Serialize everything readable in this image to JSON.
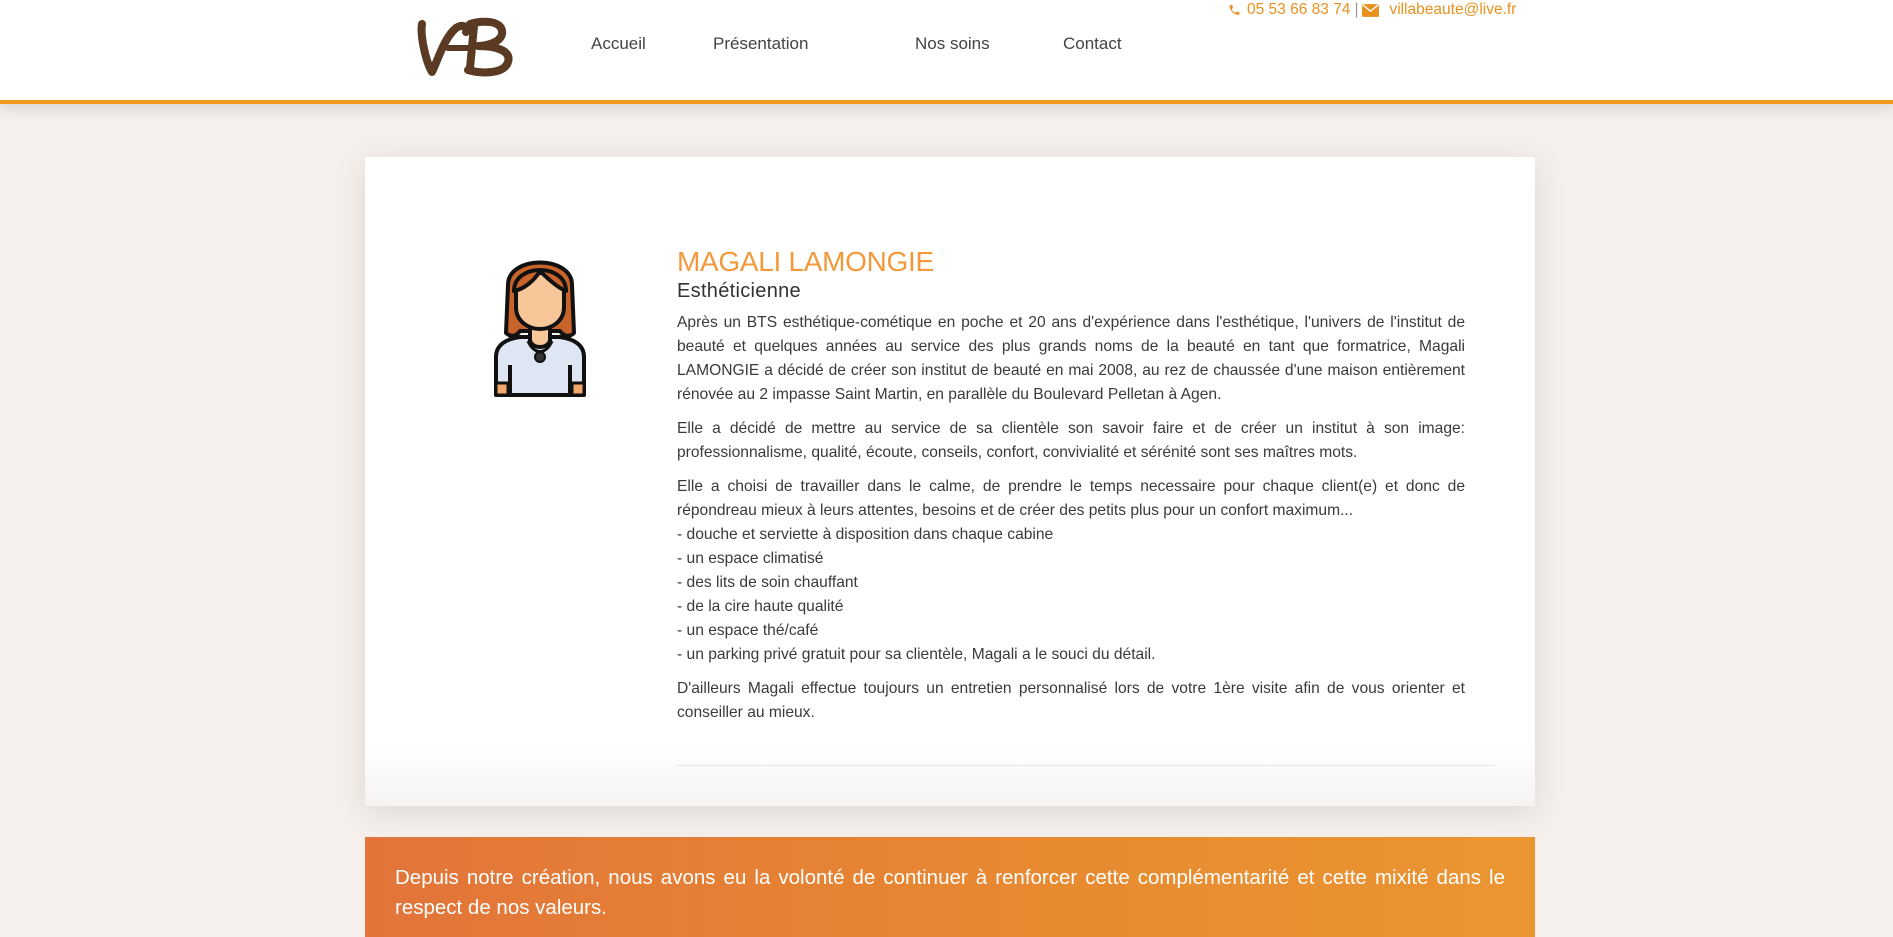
{
  "brand": {
    "logo_text": "VB",
    "accent_color": "#f29a1c",
    "logo_color": "#5a3a22"
  },
  "nav": {
    "items": [
      {
        "label": "Accueil"
      },
      {
        "label": "Présentation"
      },
      {
        "label": "Nos soins"
      },
      {
        "label": "Contact"
      }
    ]
  },
  "contact": {
    "phone_icon": "phone-icon",
    "phone": "05 53 66 83 74",
    "separator": "|",
    "mail_icon": "envelope-icon",
    "email": "villabeaute@live.fr"
  },
  "profile": {
    "avatar_icon": "woman-avatar-icon",
    "name": "MAGALI LAMONGIE",
    "role": "Esthéticienne",
    "paragraph1": "Après un BTS esthétique-cométique en poche et 20 ans d'expérience dans l'esthétique, l'univers de l'institut de beauté et quelques années au service des plus grands noms de la beauté en tant que formatrice, Magali LAMONGIE a décidé de créer son institut de beauté en mai 2008, au rez de chaussée d'une maison entièrement rénovée au 2 impasse Saint Martin, en parallèle du Boulevard Pelletan à Agen.",
    "paragraph2": "Elle a décidé de mettre au service de sa clientèle son savoir faire et de créer un institut à son image: professionnalisme, qualité, écoute, conseils, confort, convivialité et sérénité sont ses maîtres mots.",
    "paragraph3_intro": "Elle a choisi de travailler dans le calme, de prendre le temps necessaire pour chaque client(e) et donc de répondreau mieux à leurs attentes, besoins et de créer des petits plus pour un confort maximum...",
    "amenities": [
      "- douche et serviette à disposition dans chaque cabine",
      "- un espace climatisé",
      "- des lits de soin chauffant",
      "- de la cire haute qualité",
      "- un espace thé/café",
      "- un parking privé gratuit pour sa clientèle, Magali a le souci du détail."
    ],
    "paragraph4": "D'ailleurs Magali effectue toujours un entretien personnalisé lors de votre 1ère visite afin de vous orienter et conseiller au mieux."
  },
  "band": {
    "text": "Depuis notre création, nous avons eu la volonté de continuer à renforcer cette complémentarité et cette mixité dans le respect de nos valeurs."
  }
}
